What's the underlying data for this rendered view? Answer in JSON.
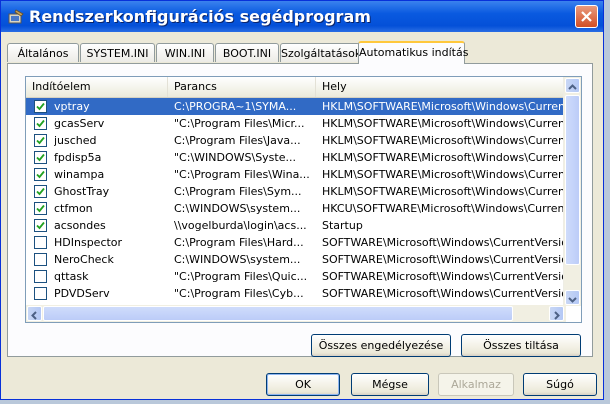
{
  "window": {
    "title": "Rendszerkonfigurációs segédprogram"
  },
  "tabs": [
    {
      "label": "Általános"
    },
    {
      "label": "SYSTEM.INI"
    },
    {
      "label": "WIN.INI"
    },
    {
      "label": "BOOT.INI"
    },
    {
      "label": "Szolgáltatások"
    },
    {
      "label": "Automatikus indítás",
      "active": true
    }
  ],
  "list": {
    "columns": [
      "Indítóelem",
      "Parancs",
      "Hely"
    ],
    "rows": [
      {
        "checked": true,
        "selected": true,
        "name": "vptray",
        "command": "C:\\PROGRA~1\\SYMA...",
        "location": "HKLM\\SOFTWARE\\Microsoft\\Windows\\CurrentVer..."
      },
      {
        "checked": true,
        "selected": false,
        "name": "gcasServ",
        "command": "\"C:\\Program Files\\Micr...",
        "location": "HKLM\\SOFTWARE\\Microsoft\\Windows\\CurrentVer..."
      },
      {
        "checked": true,
        "selected": false,
        "name": "jusched",
        "command": "C:\\Program Files\\Java...",
        "location": "HKLM\\SOFTWARE\\Microsoft\\Windows\\CurrentVer..."
      },
      {
        "checked": true,
        "selected": false,
        "name": "fpdisp5a",
        "command": "\"C:\\WINDOWS\\Syste...",
        "location": "HKLM\\SOFTWARE\\Microsoft\\Windows\\CurrentVer..."
      },
      {
        "checked": true,
        "selected": false,
        "name": "winampa",
        "command": "\"C:\\Program Files\\Wina...",
        "location": "HKLM\\SOFTWARE\\Microsoft\\Windows\\CurrentVer..."
      },
      {
        "checked": true,
        "selected": false,
        "name": "GhostTray",
        "command": "C:\\Program Files\\Sym...",
        "location": "HKLM\\SOFTWARE\\Microsoft\\Windows\\CurrentVer..."
      },
      {
        "checked": true,
        "selected": false,
        "name": "ctfmon",
        "command": "C:\\WINDOWS\\system...",
        "location": "HKCU\\SOFTWARE\\Microsoft\\Windows\\CurrentVer..."
      },
      {
        "checked": true,
        "selected": false,
        "name": "acsondes",
        "command": "\\\\vogelburda\\login\\acs...",
        "location": "Startup"
      },
      {
        "checked": false,
        "selected": false,
        "name": "HDInspector",
        "command": "C:\\Program Files\\Hard...",
        "location": "SOFTWARE\\Microsoft\\Windows\\CurrentVersion\\Ru"
      },
      {
        "checked": false,
        "selected": false,
        "name": "NeroCheck",
        "command": "C:\\WINDOWS\\system...",
        "location": "SOFTWARE\\Microsoft\\Windows\\CurrentVersion\\Ru"
      },
      {
        "checked": false,
        "selected": false,
        "name": "qttask",
        "command": "\"C:\\Program Files\\Quic...",
        "location": "SOFTWARE\\Microsoft\\Windows\\CurrentVersion\\Ru"
      },
      {
        "checked": false,
        "selected": false,
        "name": "PDVDServ",
        "command": "\"C:\\Program Files\\Cyb...",
        "location": "SOFTWARE\\Microsoft\\Windows\\CurrentVersion\\Ru"
      }
    ]
  },
  "panel_buttons": {
    "enable_all": "Összes engedélyezése",
    "disable_all": "Összes tiltása"
  },
  "dialog_buttons": {
    "ok": "OK",
    "cancel": "Mégse",
    "apply": "Alkalmaz",
    "help": "Súgó"
  },
  "colors": {
    "titlebar": "#0a5ae0",
    "selection": "#316ac5",
    "close": "#d34e24"
  }
}
